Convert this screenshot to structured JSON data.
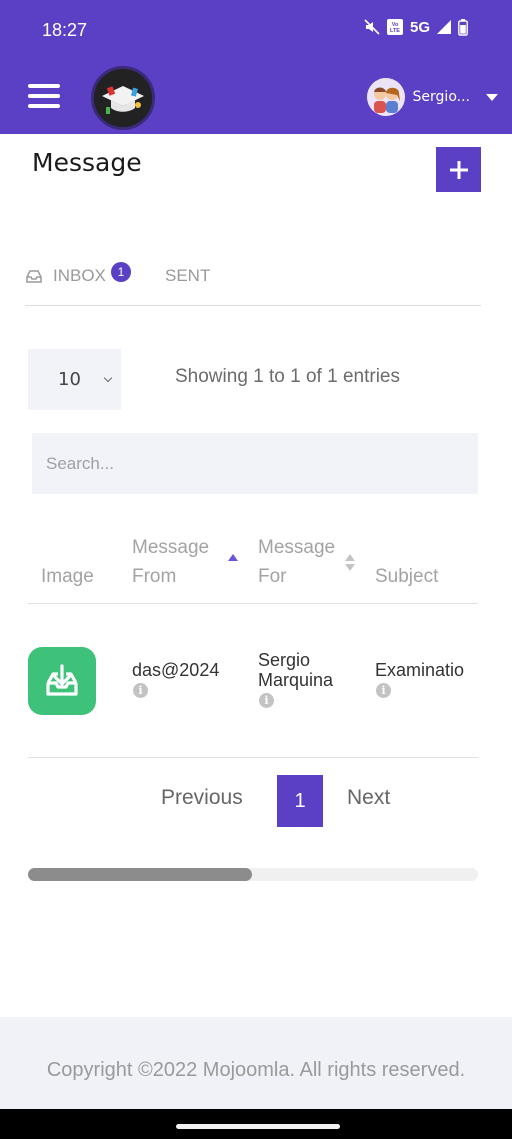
{
  "status_bar": {
    "time": "18:27",
    "network": "5G"
  },
  "header": {
    "user_name": "Sergio..."
  },
  "page": {
    "title": "Message"
  },
  "tabs": [
    {
      "label": "INBOX",
      "badge": "1"
    },
    {
      "label": "SENT"
    }
  ],
  "table_controls": {
    "page_length": "10",
    "info": "Showing 1 to 1 of 1 entries",
    "search_placeholder": "Search..."
  },
  "table": {
    "headers": [
      "Image",
      "Message From",
      "Message For",
      "Subject"
    ],
    "header_lines": {
      "from": [
        "Message",
        "From"
      ],
      "for": [
        "Message",
        "For"
      ]
    },
    "rows": [
      {
        "from": "das@2024",
        "for_lines": [
          "Sergio",
          "Marquina"
        ],
        "subject": "Examinatio"
      }
    ]
  },
  "pagination": {
    "previous": "Previous",
    "current": "1",
    "next": "Next"
  },
  "footer": {
    "copyright": "Copyright ©2022 Mojoomla. All rights reserved."
  },
  "colors": {
    "brand": "#5b3fc4",
    "icon_green": "#3ec27a"
  },
  "icons": [
    "hamburger-icon",
    "logo",
    "avatar",
    "caret-down-icon",
    "plus-icon",
    "inbox-icon",
    "info-icon",
    "download-tray-icon"
  ]
}
